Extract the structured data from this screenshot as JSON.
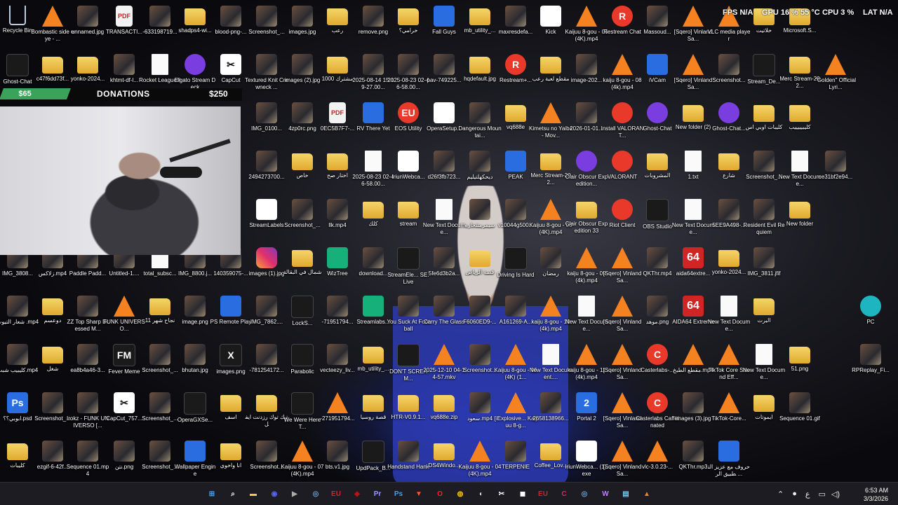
{
  "hud": {
    "fps": "FPS  N/A",
    "gpu": "GPU  16 %  55 °C",
    "cpu": "CPU  3 %",
    "lat": "LAT  N/A"
  },
  "overlay": {
    "amount_left": "$65",
    "title": "DONATIONS",
    "amount_right": "$250"
  },
  "desktop_icons": [
    {
      "label": "Recycle Bin",
      "icon": "recycle-bin-icon"
    },
    {
      "label": "Bombastic side eye - ...",
      "icon": "vlc-icon"
    },
    {
      "label": "unnamed.jpg",
      "icon": "image-icon"
    },
    {
      "label": "TRANSACTI...",
      "icon": "pdf-icon"
    },
    {
      "label": "-633198719...",
      "icon": "image-icon"
    },
    {
      "label": "shadps4-wi...",
      "icon": "folder-icon"
    },
    {
      "label": "blood-png-...",
      "icon": "image-icon"
    },
    {
      "label": "Screenshot_...",
      "icon": "image-icon"
    },
    {
      "label": "images.jpg",
      "icon": "image-icon"
    },
    {
      "label": "رعب",
      "icon": "folder-icon"
    },
    {
      "label": "remove.png",
      "icon": "image-icon"
    },
    {
      "label": "خرامي؟",
      "icon": "folder-icon"
    },
    {
      "label": "Fall Guys",
      "icon": "game-icon"
    },
    {
      "label": "mb_utility_...",
      "icon": "folder-icon"
    },
    {
      "label": "maxresdefa...",
      "icon": "image-icon"
    },
    {
      "label": "Kick",
      "icon": "chrome-icon"
    },
    {
      "label": "Kaijuu 8-gou - 05 (4K).mp4",
      "icon": "vlc-icon"
    },
    {
      "label": "Restream Chat",
      "icon": "restream-icon"
    },
    {
      "label": "Massoud...",
      "icon": "image-icon"
    },
    {
      "label": "[Sqero] Vinland Sa...",
      "icon": "vlc-icon"
    },
    {
      "label": "VLC media player",
      "icon": "vlc-icon"
    },
    {
      "label": "خلاتيت",
      "icon": "folder-icon"
    },
    {
      "label": "Microsoft.S...",
      "icon": "folder-icon"
    },
    {
      "label": "Ghost-Chat",
      "icon": "app-icon"
    },
    {
      "label": "c47f6dd73f...",
      "icon": "folder-icon"
    },
    {
      "label": "yonko-2024...",
      "icon": "folder-icon"
    },
    {
      "label": "khtmt-df-l...",
      "icon": "image-icon"
    },
    {
      "label": "Rocket League®",
      "icon": "file-icon"
    },
    {
      "label": "Elgato Stream Deck",
      "icon": "elgato-icon"
    },
    {
      "label": "CapCut",
      "icon": "capcut-icon"
    },
    {
      "label": "Textured Knit Crewneck ...",
      "icon": "image-icon"
    },
    {
      "label": "images (2).jpg",
      "icon": "image-icon"
    },
    {
      "label": "مشترك 1000",
      "icon": "folder-icon"
    },
    {
      "label": "2025-08-14 15-19-27.00...",
      "icon": "image-icon"
    },
    {
      "label": "2025-08-23 02-46-58.00...",
      "icon": "image-icon"
    },
    {
      "label": "pav-749225...",
      "icon": "image-icon"
    },
    {
      "label": "hqdefault.jpg",
      "icon": "folder-icon"
    },
    {
      "label": "Restream+...",
      "icon": "restream-icon"
    },
    {
      "label": "مقطع لعبة رعب",
      "icon": "folder-icon"
    },
    {
      "label": "image-202...",
      "icon": "image-icon"
    },
    {
      "label": "kaiju 8-gou - 08 (4k).mp4",
      "icon": "vlc-icon"
    },
    {
      "label": "iVCam",
      "icon": "ivcam-icon"
    },
    {
      "label": "[Sqero] Vinland Sa...",
      "icon": "vlc-icon"
    },
    {
      "label": "Screenshot...",
      "icon": "image-icon"
    },
    {
      "label": "Stream_De...",
      "icon": "app-icon"
    },
    {
      "label": "Merc Stream-202...",
      "icon": "folder-icon"
    },
    {
      "label": "\"Golden\" Official Lyri...",
      "icon": "vlc-icon"
    },
    {
      "label": "IMG_0100...",
      "icon": "image-icon"
    },
    {
      "label": "4zp0rc.png",
      "icon": "image-icon"
    },
    {
      "label": "0EC5B7F7-...",
      "icon": "pdf-icon"
    },
    {
      "label": "RV There Yet",
      "icon": "game-icon"
    },
    {
      "label": "EOS Utility",
      "icon": "eos-icon"
    },
    {
      "label": "OperaSetup...",
      "icon": "opera-icon"
    },
    {
      "label": "Dangerous Mountai...",
      "icon": "image-icon"
    },
    {
      "label": "vq688e",
      "icon": "folder-icon"
    },
    {
      "label": "Kimetsu no Yaiba - Mov...",
      "icon": "vlc-icon"
    },
    {
      "label": "2026-01-01...",
      "icon": "image-icon"
    },
    {
      "label": "Install VALORANT...",
      "icon": "valorant-icon"
    },
    {
      "label": "Ghost-Chat",
      "icon": "ghost-chat-icon"
    },
    {
      "label": "New folder (2)",
      "icon": "folder-icon"
    },
    {
      "label": "Ghost-Chat...",
      "icon": "ghost-chat-icon"
    },
    {
      "label": "كليبات اوبي اس",
      "icon": "folder-icon"
    },
    {
      "label": "كليبيييييب",
      "icon": "folder-icon"
    },
    {
      "label": "2494273700...",
      "icon": "image-icon"
    },
    {
      "label": "خاص",
      "icon": "folder-icon"
    },
    {
      "label": "اختار صح",
      "icon": "folder-icon"
    },
    {
      "label": "2025-08-23 02-46-58.00...",
      "icon": "file-icon"
    },
    {
      "label": "IriunWebca...",
      "icon": "iriun-icon"
    },
    {
      "label": "d26f3fb723...",
      "icon": "image-icon"
    },
    {
      "label": "ديحكهلتيليم",
      "icon": "image-icon"
    },
    {
      "label": "PEAK",
      "icon": "peak-icon"
    },
    {
      "label": "Merc Stream-202...",
      "icon": "folder-icon"
    },
    {
      "label": "Clair Obscur Expedition...",
      "icon": "winrar-icon"
    },
    {
      "label": "VALORANT",
      "icon": "valorant-icon"
    },
    {
      "label": "المشروبات",
      "icon": "folder-icon"
    },
    {
      "label": "1.txt",
      "icon": "file-icon"
    },
    {
      "label": "شارع",
      "icon": "folder-icon"
    },
    {
      "label": "Screenshot_...",
      "icon": "image-icon"
    },
    {
      "label": "New Text Docume...",
      "icon": "file-icon"
    },
    {
      "label": "ce31bf2e94...",
      "icon": "image-icon"
    },
    {
      "label": "StreamLabels",
      "icon": "streamlabels-icon"
    },
    {
      "label": "Screenshot_...",
      "icon": "image-icon"
    },
    {
      "label": "llk.mp4",
      "icon": "image-icon"
    },
    {
      "label": "كلك",
      "icon": "folder-icon"
    },
    {
      "label": "stream",
      "icon": "folder-icon"
    },
    {
      "label": "New Text Docume...",
      "icon": "file-icon"
    },
    {
      "label": "سيمرمتتحاره",
      "icon": "image-icon"
    },
    {
      "label": "v10044g500...",
      "icon": "image-icon"
    },
    {
      "label": "Kaijuu 8-gou - 06 (4K).mp4",
      "icon": "vlc-icon"
    },
    {
      "label": "Clair Obscur Expedition 33",
      "icon": "folder-icon"
    },
    {
      "label": "Riot Client",
      "icon": "riot-icon"
    },
    {
      "label": "OBS Studio",
      "icon": "obs-icon"
    },
    {
      "label": "New Text Docume...",
      "icon": "file-icon"
    },
    {
      "label": "5EE9A498-...",
      "icon": "image-icon"
    },
    {
      "label": "Resident Evil Requiem",
      "icon": "image-icon"
    },
    {
      "label": "New folder",
      "icon": "folder-icon"
    },
    {
      "label": "IMG_3808...",
      "icon": "image-icon"
    },
    {
      "label": "زلاكس.mp4",
      "icon": "image-icon"
    },
    {
      "label": "Paddle Padd...",
      "icon": "image-icon"
    },
    {
      "label": "Untitled-1....",
      "icon": "image-icon"
    },
    {
      "label": "total_subsc...",
      "icon": "file-icon"
    },
    {
      "label": "IMG_8800.j...",
      "icon": "image-icon"
    },
    {
      "label": "140359075-...",
      "icon": "image-icon"
    },
    {
      "label": "images (1).jpg",
      "icon": "instagram-icon"
    },
    {
      "label": "شمال في البقالة",
      "icon": "folder-icon"
    },
    {
      "label": "WizTree",
      "icon": "wiztree-icon"
    },
    {
      "label": "download...",
      "icon": "image-icon"
    },
    {
      "label": "StreamEle... SE.Live",
      "icon": "app-icon"
    },
    {
      "label": "5fe6d3b2a...",
      "icon": "image-icon"
    },
    {
      "label": "قصة الرياض",
      "icon": "folder-icon"
    },
    {
      "label": "Driving Is Hard",
      "icon": "app-icon"
    },
    {
      "label": "رمضان",
      "icon": "image-icon"
    },
    {
      "label": "kaiju 8-gou - 09 (4k).mp4",
      "icon": "vlc-icon"
    },
    {
      "label": "[Sqero] Vinland Sa...",
      "icon": "vlc-icon"
    },
    {
      "label": "QKThr.mp4",
      "icon": "image-icon"
    },
    {
      "label": "aida64extre...",
      "icon": "aida64-icon"
    },
    {
      "label": "yonko-2024...",
      "icon": "folder-icon"
    },
    {
      "label": "IMG_3811.jfif",
      "icon": "image-icon"
    },
    {
      "label": "شعار التيوب .mp4",
      "icon": "image-icon"
    },
    {
      "label": "دوعسم",
      "icon": "folder-icon"
    },
    {
      "label": "ZZ Top Sharp Dressed M...",
      "icon": "image-icon"
    },
    {
      "label": "FUNK UNIVERSO...",
      "icon": "vlc-icon"
    },
    {
      "label": "نجاح شهر 11",
      "icon": "folder-icon"
    },
    {
      "label": "image.png",
      "icon": "image-icon"
    },
    {
      "label": "PS Remote Play",
      "icon": "ps-remote-icon"
    },
    {
      "label": "IMG_7862....",
      "icon": "image-icon"
    },
    {
      "label": "LockS...",
      "icon": "app-icon"
    },
    {
      "label": "-71951794...",
      "icon": "image-icon"
    },
    {
      "label": "Streamlabs...",
      "icon": "streamlabs-icon"
    },
    {
      "label": "You Suck At Football",
      "icon": "image-icon"
    },
    {
      "label": "Carry The Glass",
      "icon": "image-icon"
    },
    {
      "label": "F6060ED9-...",
      "icon": "image-icon"
    },
    {
      "label": "A161269-A...",
      "icon": "image-icon"
    },
    {
      "label": "kaiju 8-gou - 10 (4k).mp4",
      "icon": "vlc-icon"
    },
    {
      "label": "New Text Docume...",
      "icon": "file-icon"
    },
    {
      "label": "[Sqero] Vinland Sa...",
      "icon": "vlc-icon"
    },
    {
      "label": "موهد.png",
      "icon": "image-icon"
    },
    {
      "label": "AIDA64 Extreme",
      "icon": "aida64-icon"
    },
    {
      "label": "New Text Docume...",
      "icon": "file-icon"
    },
    {
      "label": "البرت",
      "icon": "folder-icon"
    },
    {
      "label": "PC",
      "icon": "pc-icon"
    },
    {
      "label": "كليبيب شبت.mp4",
      "icon": "image-icon"
    },
    {
      "label": "شغل",
      "icon": "folder-icon"
    },
    {
      "label": "ea8b4a46-3...",
      "icon": "image-icon"
    },
    {
      "label": "Fever Meme",
      "icon": "fm-icon"
    },
    {
      "label": "Screenshot_...",
      "icon": "image-icon"
    },
    {
      "label": "bhutan.jpg",
      "icon": "image-icon"
    },
    {
      "label": "images.png",
      "icon": "x-icon"
    },
    {
      "label": "-781254172...",
      "icon": "image-icon"
    },
    {
      "label": "Parabolic",
      "icon": "app-icon"
    },
    {
      "label": "vecteezy_liv...",
      "icon": "image-icon"
    },
    {
      "label": "mb_utility_...",
      "icon": "folder-icon"
    },
    {
      "label": "DON'T SCREAM...",
      "icon": "app-icon"
    },
    {
      "label": "2025-12-10 04-14-57.mkv",
      "icon": "vlc-icon"
    },
    {
      "label": "Screenshot...",
      "icon": "image-icon"
    },
    {
      "label": "Kaijuu 8-gou - 06 (4K) (1...",
      "icon": "vlc-icon"
    },
    {
      "label": "New Text Document....",
      "icon": "file-icon"
    },
    {
      "label": "kaiju 8-gou - 11 (4k).mp4",
      "icon": "vlc-icon"
    },
    {
      "label": "[Sqero] Vinland Sa...",
      "icon": "vlc-icon"
    },
    {
      "label": "Casterlabs-...",
      "icon": "casterlabs-icon"
    },
    {
      "label": "مقطع الطبخ.mp4",
      "icon": "vlc-icon"
    },
    {
      "label": "TikTok Core Sound Eff...",
      "icon": "vlc-icon"
    },
    {
      "label": "New Text Docume...",
      "icon": "file-icon"
    },
    {
      "label": "51.png",
      "icon": "folder-icon"
    },
    {
      "label": "RPReplay_Fi...",
      "icon": "image-icon"
    },
    {
      "label": "ابوبي؟؟.psd",
      "icon": "psd-icon"
    },
    {
      "label": "Screenshot_...",
      "icon": "image-icon"
    },
    {
      "label": "Irokz - FUNK UNIVERSO [...",
      "icon": "image-icon"
    },
    {
      "label": "CapCut_757...",
      "icon": "capcut-icon"
    },
    {
      "label": "Screenshot_...",
      "icon": "image-icon"
    },
    {
      "label": "OperaGXSe...",
      "icon": "opera-gx-icon"
    },
    {
      "label": "اسف",
      "icon": "folder-icon"
    },
    {
      "label": "تيك توك رزدنت ايفل",
      "icon": "folder-icon"
    },
    {
      "label": "We Were Here T...",
      "icon": "app-icon"
    },
    {
      "label": "-271951794...",
      "icon": "vlc-icon"
    },
    {
      "label": "قصة روسيا",
      "icon": "folder-icon"
    },
    {
      "label": "HTR-V0.9.1...",
      "icon": "folder-icon"
    },
    {
      "label": "vq688e.zip",
      "icon": "folder-icon"
    },
    {
      "label": "سعود.mp4",
      "icon": "image-icon"
    },
    {
      "label": "[iExplosive... Kaijuu 8-g...",
      "icon": "vlc-icon"
    },
    {
      "label": "2658138966...",
      "icon": "image-icon"
    },
    {
      "label": "Portal 2",
      "icon": "portal-icon"
    },
    {
      "label": "[Sqero] Vinland Sa...",
      "icon": "vlc-icon"
    },
    {
      "label": "Casterlabs Caffeinated",
      "icon": "casterlabs-icon"
    },
    {
      "label": "images (3).jpg",
      "icon": "image-icon"
    },
    {
      "label": "TikTok-Core...",
      "icon": "vlc-icon"
    },
    {
      "label": "ايموتات",
      "icon": "folder-icon"
    },
    {
      "label": "Sequence 01.gif",
      "icon": "image-icon"
    },
    {
      "label": "كليبات",
      "icon": "folder-icon"
    },
    {
      "label": "ezgif-6-42f...",
      "icon": "image-icon"
    },
    {
      "label": "Sequence 01.mp4",
      "icon": "image-icon"
    },
    {
      "label": "نتن.png",
      "icon": "image-icon"
    },
    {
      "label": "Screenshot_...",
      "icon": "image-icon"
    },
    {
      "label": "Wallpaper Engine",
      "icon": "wallpaper-engine-icon"
    },
    {
      "label": "انا واخوي",
      "icon": "folder-icon"
    },
    {
      "label": "Screenshot...",
      "icon": "image-icon"
    },
    {
      "label": "Kaijuu 8-gou - 07 (4K).mp4",
      "icon": "vlc-icon"
    },
    {
      "label": "bts.v1.jpg",
      "icon": "image-icon"
    },
    {
      "label": "UpdPack_B...",
      "icon": "app-icon"
    },
    {
      "label": "Handstand Hank",
      "icon": "image-icon"
    },
    {
      "label": "DS4Windo...",
      "icon": "folder-icon"
    },
    {
      "label": "Kaijuu 8-gou - 04 (4K).mp4",
      "icon": "vlc-icon"
    },
    {
      "label": "TERPENIE",
      "icon": "image-icon"
    },
    {
      "label": "Coffee_Lov...",
      "icon": "folder-icon"
    },
    {
      "label": "IriunWebca... (1).exe",
      "icon": "iriun-icon"
    },
    {
      "label": "[Sqero] Vinland Sa...",
      "icon": "vlc-icon"
    },
    {
      "label": "vlc-3.0.23-...",
      "icon": "vlc-icon"
    },
    {
      "label": "QKThr.mp3",
      "icon": "image-icon"
    },
    {
      "label": "حروف مع عزيز التطبيق الر ...",
      "icon": "download-icon"
    }
  ],
  "taskbar": {
    "apps": [
      {
        "name": "start-button",
        "glyph": "⊞",
        "color": "#4aa3ff"
      },
      {
        "name": "search-icon",
        "glyph": "⌕",
        "color": "#ffffff"
      },
      {
        "name": "file-explorer-icon",
        "glyph": "▬",
        "color": "#f2c94c"
      },
      {
        "name": "discord-icon",
        "glyph": "◉",
        "color": "#5865f2"
      },
      {
        "name": "media-icon",
        "glyph": "▶",
        "color": "#aaaaaa"
      },
      {
        "name": "steam-icon",
        "glyph": "◎",
        "color": "#6aa0d0"
      },
      {
        "name": "eos-icon",
        "glyph": "EU",
        "color": "#d02525"
      },
      {
        "name": "app-icon",
        "glyph": "◆",
        "color": "#c01010"
      },
      {
        "name": "premiere-icon",
        "glyph": "Pr",
        "color": "#9999ff"
      },
      {
        "name": "photoshop-icon",
        "glyph": "Ps",
        "color": "#31a8ff"
      },
      {
        "name": "brave-icon",
        "glyph": "▼",
        "color": "#fb542b"
      },
      {
        "name": "opera-icon",
        "glyph": "O",
        "color": "#ff1b2d"
      },
      {
        "name": "chrome-icon",
        "glyph": "◍",
        "color": "#fbbc05"
      },
      {
        "name": "obs-icon",
        "glyph": "◐",
        "color": "#dddddd"
      },
      {
        "name": "capcut-icon",
        "glyph": "✂",
        "color": "#ffffff"
      },
      {
        "name": "game-icon",
        "glyph": "◼",
        "color": "#ffffff"
      },
      {
        "name": "eos-utility-icon",
        "glyph": "EU",
        "color": "#d02525"
      },
      {
        "name": "casterlabs-icon",
        "glyph": "C",
        "color": "#e0245e"
      },
      {
        "name": "steam-alt-icon",
        "glyph": "◎",
        "color": "#6aa0d0"
      },
      {
        "name": "wow-icon",
        "glyph": "W",
        "color": "#c080ff"
      },
      {
        "name": "notepad-icon",
        "glyph": "▤",
        "color": "#6ad0f0"
      },
      {
        "name": "vlc-icon",
        "glyph": "▲",
        "color": "#f58220"
      }
    ],
    "tray": {
      "lang": "ع",
      "chevron": "⌃"
    },
    "clock": {
      "time": "6:53 AM",
      "date": "3/3/2026"
    }
  }
}
